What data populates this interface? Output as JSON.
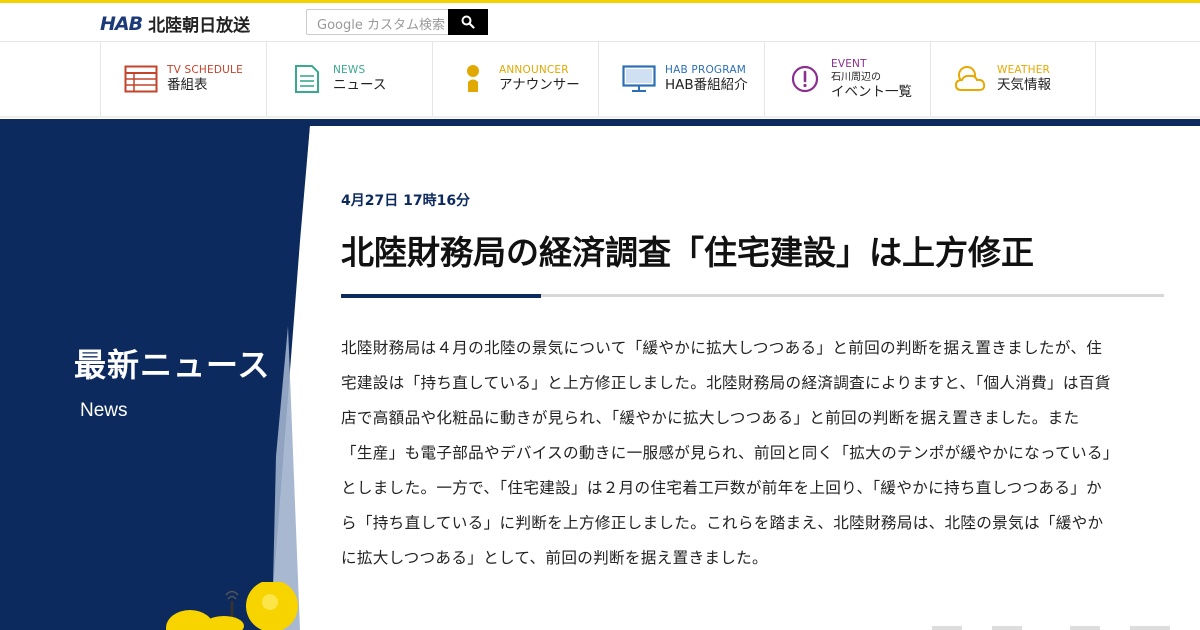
{
  "header": {
    "logo_mark": "HAB",
    "logo_text": "北陸朝日放送",
    "search_placeholder": "Google カスタム検索"
  },
  "nav": [
    {
      "en": "TV SCHEDULE",
      "ja": "番組表",
      "icon": "tv-schedule-icon",
      "color": "#c4432b"
    },
    {
      "en": "NEWS",
      "ja": "ニュース",
      "icon": "news-icon",
      "color": "#3aa88f"
    },
    {
      "en": "ANNOUNCER",
      "ja": "アナウンサー",
      "icon": "announcer-icon",
      "color": "#e0a800"
    },
    {
      "en": "HAB PROGRAM",
      "ja": "HAB番組紹介",
      "icon": "monitor-icon",
      "color": "#2d6fb5"
    },
    {
      "en": "EVENT",
      "ja_small": "石川周辺の",
      "ja": "イベント一覧",
      "icon": "alert-circle-icon",
      "color": "#8a2f8f"
    },
    {
      "en": "WEATHER",
      "ja": "天気情報",
      "icon": "weather-icon",
      "color": "#e8a800"
    }
  ],
  "section": {
    "title_ja": "最新ニュース",
    "title_en": "News"
  },
  "article": {
    "date": "4月27日 17時16分",
    "title": "北陸財務局の経済調査「住宅建設」は上方修正",
    "body": "北陸財務局は４月の北陸の景気について「緩やかに拡大しつつある」と前回の判断を据え置きましたが、住宅建設は「持ち直している」と上方修正しました。北陸財務局の経済調査によりますと、「個人消費」は百貨店で高額品や化粧品に動きが見られ、「緩やかに拡大しつつある」と前回の判断を据え置きました。また「生産」も電子部品やデバイスの動きに一服感が見られ、前回と同く「拡大のテンポが緩やかになっている」としました。一方で、「住宅建設」は２月の住宅着工戸数が前年を上回り、「緩やかに持ち直しつつある」から「持ち直している」に判断を上方修正しました。これらを踏まえ、北陸財務局は、北陸の景気は「緩やかに拡大しつつある」として、前回の判断を据え置きました。"
  },
  "colors": {
    "navy": "#0d2a5e",
    "accent_yellow": "#f2d200"
  }
}
